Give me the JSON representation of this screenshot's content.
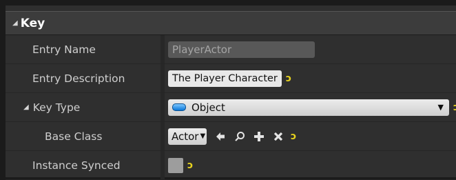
{
  "category": {
    "title": "Key"
  },
  "rows": {
    "entry_name": {
      "label": "Entry Name",
      "value": "PlayerActor"
    },
    "entry_description": {
      "label": "Entry Description",
      "value": "The Player Character"
    },
    "key_type": {
      "label": "Key Type",
      "value": "Object"
    },
    "base_class": {
      "label": "Base Class",
      "value": "Actor"
    },
    "instance_synced": {
      "label": "Instance Synced",
      "checked": false
    }
  },
  "icons": {
    "reset": "reset-to-default-icon",
    "back": "arrow-left-icon",
    "browse": "search-icon",
    "add": "plus-icon",
    "clear": "x-icon"
  },
  "colors": {
    "panel_bg": "#2f2f2f",
    "header_bg": "#3c3c3c",
    "reset_arrow": "#e6d21e",
    "object_pill": "#0a77d8"
  }
}
